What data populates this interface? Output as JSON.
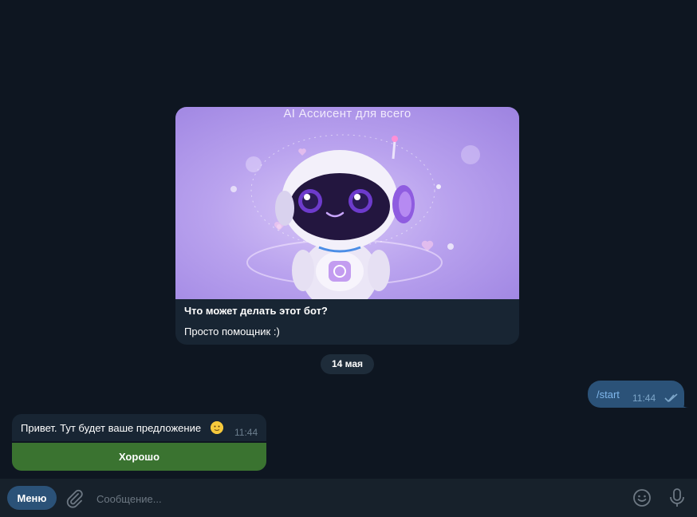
{
  "bot_intro": {
    "image_title": "AI Ассисент для всего",
    "heading": "Что может делать этот бот?",
    "body": "Просто помощник :)"
  },
  "date_separator": "14 мая",
  "messages": [
    {
      "direction": "outgoing",
      "text": "/start",
      "time": "11:44",
      "status": "read"
    },
    {
      "direction": "incoming",
      "text": "Привет. Тут будет ваше предложение",
      "emoji": "slightly-smiling-face",
      "time": "11:44"
    }
  ],
  "inline_keyboard": {
    "button_label": "Хорошо"
  },
  "composer": {
    "menu_label": "Меню",
    "placeholder": "Сообщение...",
    "icons": [
      "attach-icon",
      "emoji-icon",
      "microphone-icon"
    ]
  },
  "colors": {
    "background": "#0e1621",
    "outgoing_bubble": "#2b5278",
    "incoming_bubble": "#182533",
    "inline_button": "#3a7330",
    "composer": "#17212b"
  }
}
